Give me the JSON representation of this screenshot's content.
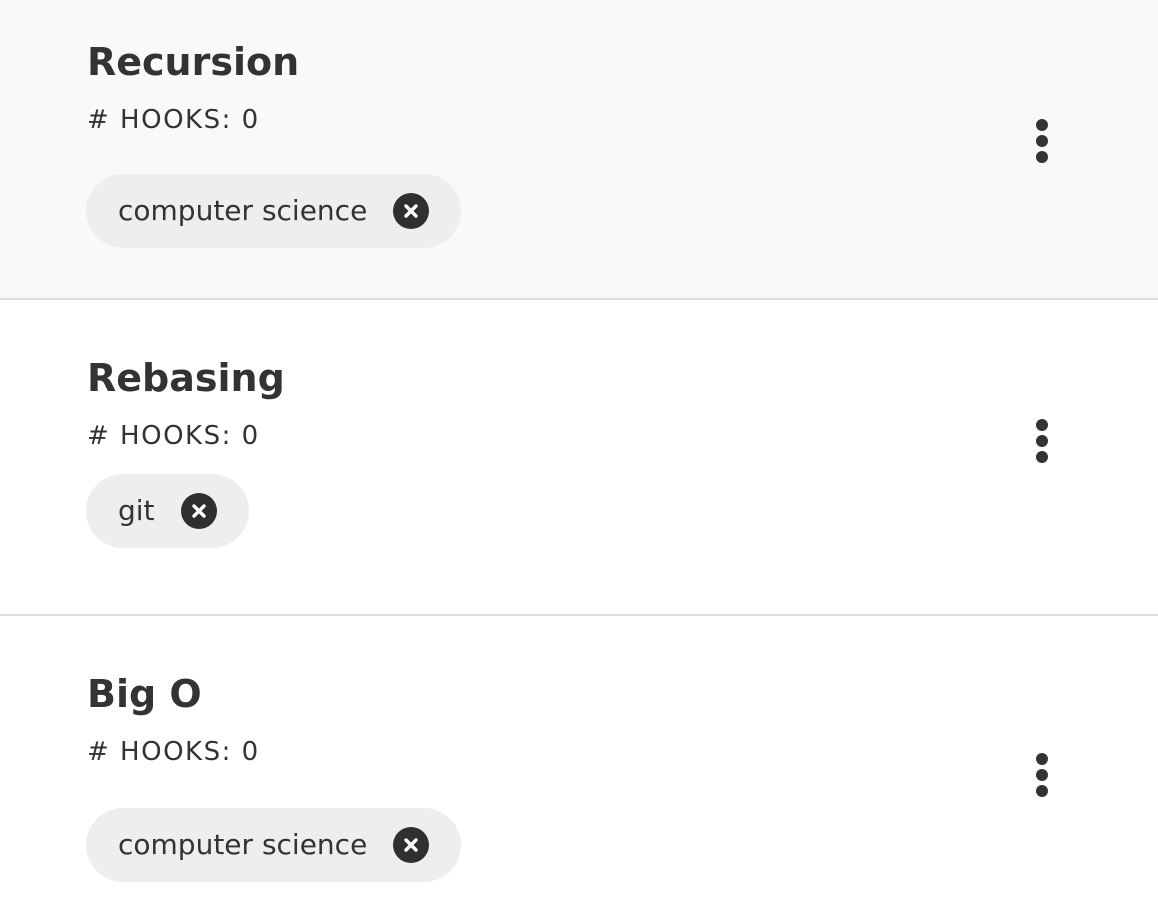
{
  "items": [
    {
      "title": "Recursion",
      "hooks_text": "# HOOKS: 0",
      "tag": {
        "label": "computer science",
        "remove_icon": "close-circle-icon"
      },
      "menu_icon": "more-vertical-icon",
      "selected": true
    },
    {
      "title": "Rebasing",
      "hooks_text": "# HOOKS: 0",
      "tag": {
        "label": "git",
        "remove_icon": "close-circle-icon"
      },
      "menu_icon": "more-vertical-icon",
      "selected": false
    },
    {
      "title": "Big O",
      "hooks_text": "# HOOKS: 0",
      "tag": {
        "label": "computer science",
        "remove_icon": "close-circle-icon"
      },
      "menu_icon": "more-vertical-icon",
      "selected": false
    }
  ],
  "colors": {
    "text": "#333333",
    "selected_background": "#f9f9f9",
    "chip_background": "#eeeeee",
    "divider": "#dcdcdc"
  }
}
